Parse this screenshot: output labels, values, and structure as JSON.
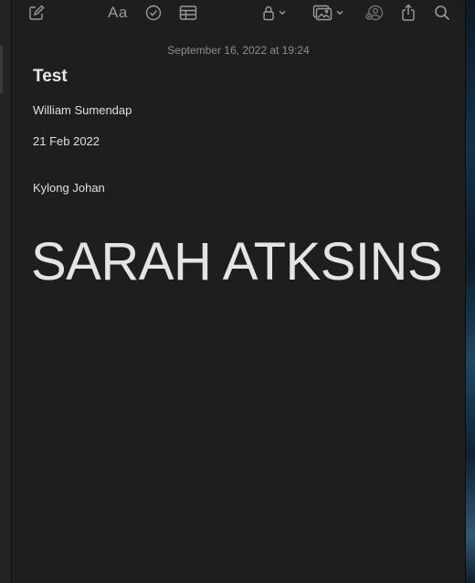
{
  "toolbar": {
    "items": [
      {
        "icon": "compose-icon"
      },
      {
        "icon": "format-text-icon",
        "label": "Aa"
      },
      {
        "icon": "checklist-icon"
      },
      {
        "icon": "table-icon"
      },
      {
        "icon": "lock-icon"
      },
      {
        "icon": "media-icon"
      },
      {
        "icon": "collaborate-icon"
      },
      {
        "icon": "share-icon"
      },
      {
        "icon": "search-icon"
      }
    ]
  },
  "note": {
    "timestamp": "September 16, 2022 at 19:24",
    "title": "Test",
    "lines": [
      "William Sumendap",
      "21 Feb 2022",
      "Kylong Johan"
    ],
    "big_text": "SARAH ATKSINS"
  },
  "colors": {
    "pane_background": "#1e1e1e",
    "text": "#e6e6e6",
    "icon": "#9a9a9e"
  }
}
